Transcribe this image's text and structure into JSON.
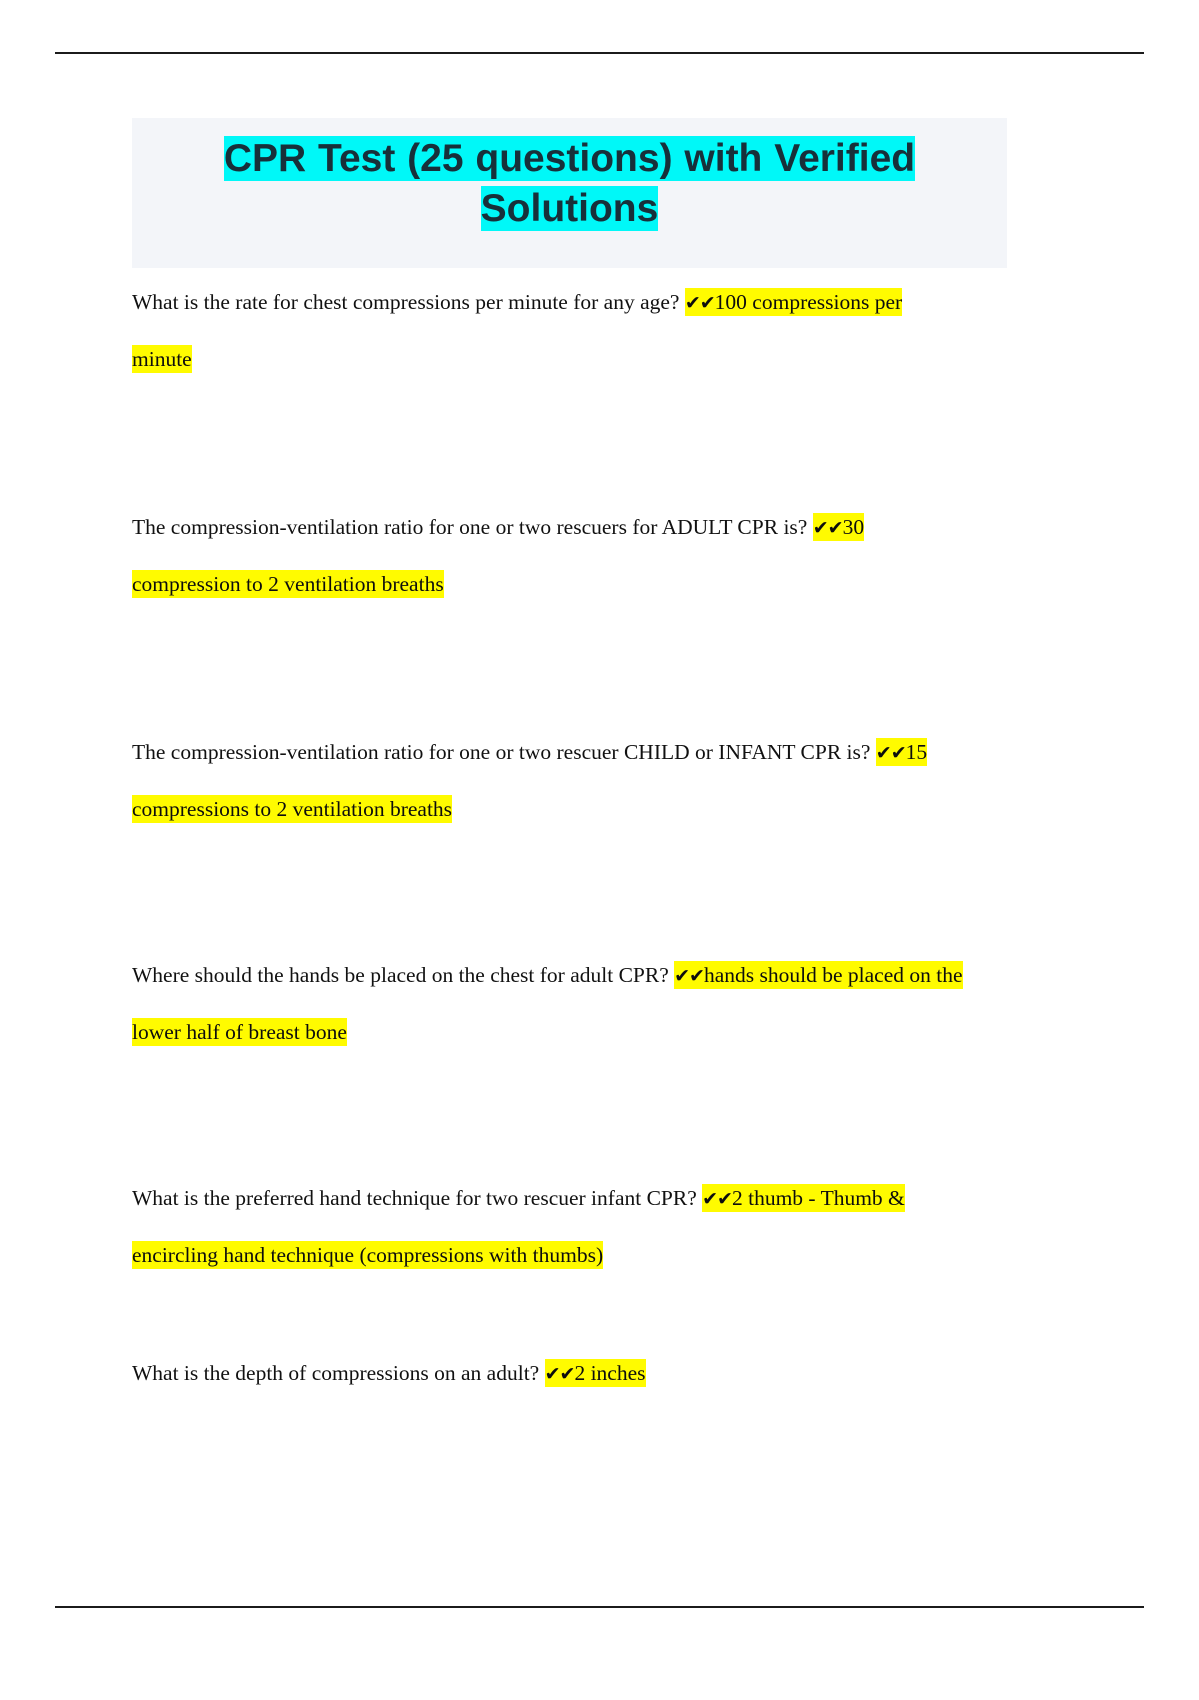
{
  "document": {
    "title_line1": "CPR Test (25 questions) with Verified",
    "title_line2": "Solutions",
    "tick_marks": "✔✔",
    "items": [
      {
        "question": "What is the rate for chest compressions per minute for any age?",
        "answer_line1": "100 compressions per",
        "answer_line2": "minute"
      },
      {
        "question": "The compression-ventilation ratio for one or two rescuers for ADULT CPR is?",
        "answer_line1": "30",
        "answer_line2": "compression to 2 ventilation breaths"
      },
      {
        "question": "The compression-ventilation ratio for one or two rescuer CHILD or INFANT CPR is?",
        "answer_line1": "15",
        "answer_line2": "compressions to 2 ventilation breaths"
      },
      {
        "question": "Where should the hands be placed on the chest for adult CPR?",
        "answer_line1": "hands should be placed on the",
        "answer_line2": "lower half of breast bone"
      },
      {
        "question": "What is the preferred hand technique for two rescuer infant CPR?",
        "answer_line1": "2 thumb - Thumb &",
        "answer_line2": "encircling hand technique (compressions with thumbs)"
      },
      {
        "question": "What is the depth of compressions on an adult?",
        "answer_line1": "2 inches",
        "answer_line2": ""
      }
    ],
    "colors": {
      "highlight_yellow": "#fffb00",
      "highlight_cyan": "#00f8f8",
      "title_text": "#17303a",
      "title_panel": "#f3f5f9",
      "body_text": "#0d0d0d",
      "rule": "#1b1b1b"
    }
  }
}
